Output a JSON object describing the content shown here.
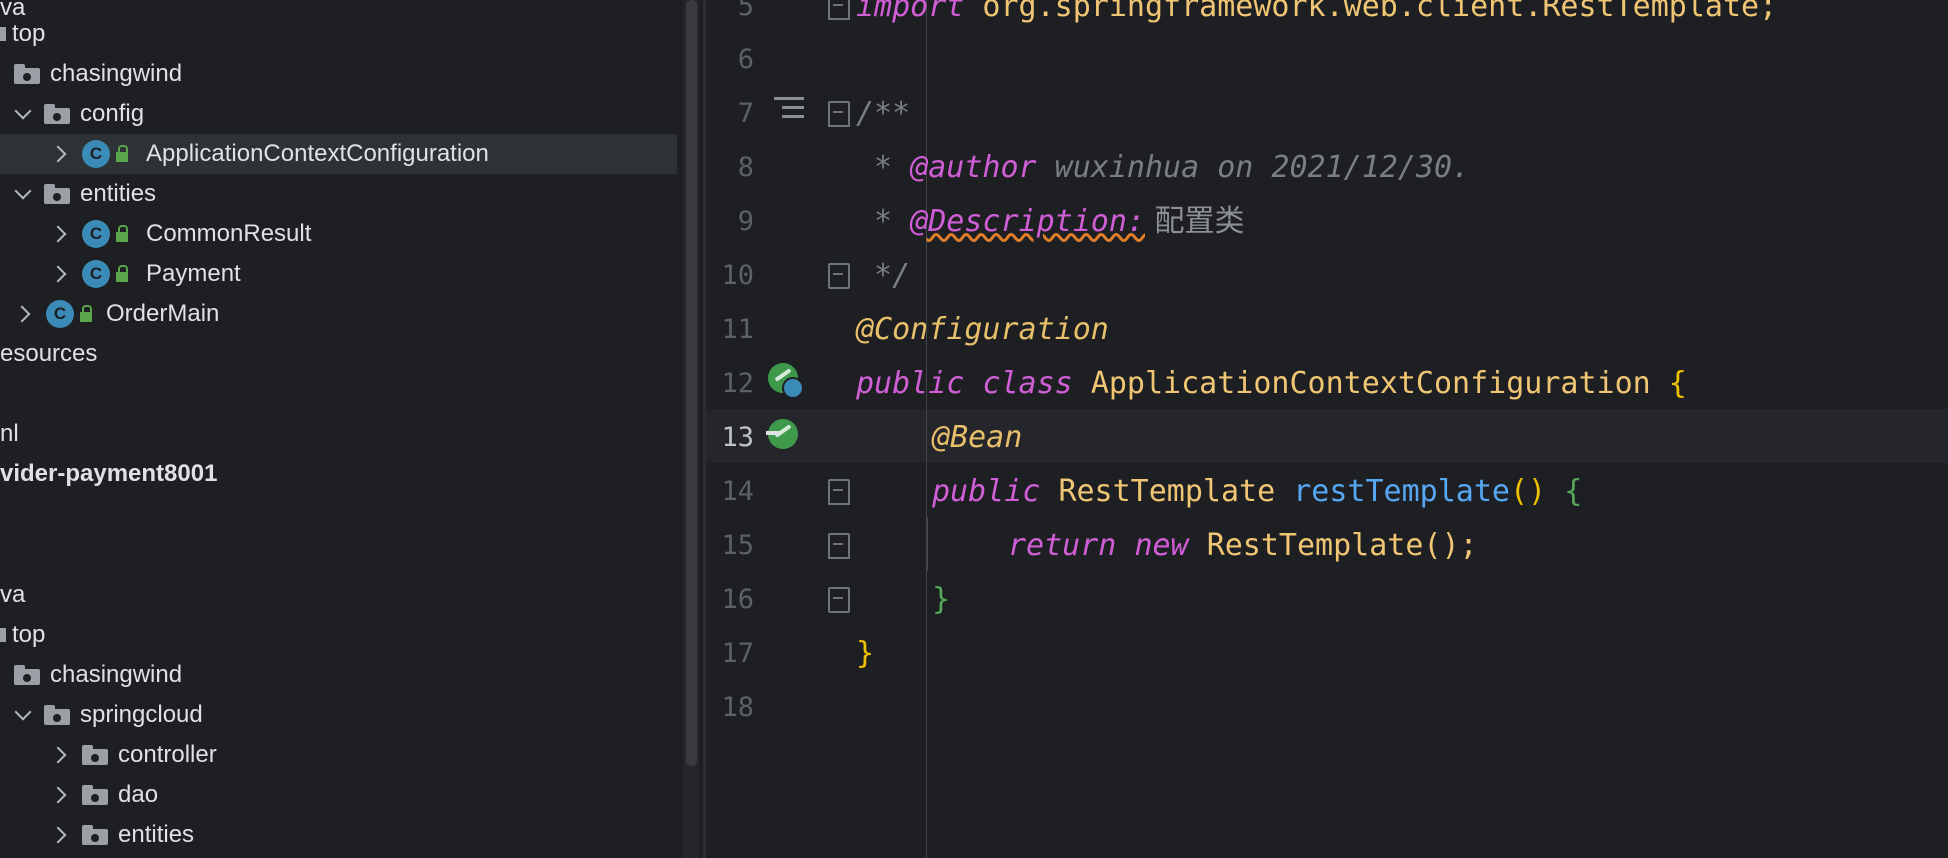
{
  "sidebar": {
    "rows": [
      {
        "label": "va",
        "indent": 0
      },
      {
        "label": "top"
      },
      {
        "label": "chasingwind"
      },
      {
        "label": "config"
      },
      {
        "label": "ApplicationContextConfiguration"
      },
      {
        "label": "entities"
      },
      {
        "label": "CommonResult"
      },
      {
        "label": "Payment"
      },
      {
        "label": "OrderMain"
      },
      {
        "label": "esources"
      },
      {
        "label": "nl"
      },
      {
        "label": "vider-payment8001"
      },
      {
        "label": "va"
      },
      {
        "label": "top"
      },
      {
        "label": "chasingwind"
      },
      {
        "label": "springcloud"
      },
      {
        "label": "controller"
      },
      {
        "label": "dao"
      },
      {
        "label": "entities"
      }
    ],
    "class_icon_letter": "C"
  },
  "editor": {
    "line_numbers": [
      "5",
      "6",
      "7",
      "8",
      "9",
      "10",
      "11",
      "12",
      "13",
      "14",
      "15",
      "16",
      "17",
      "18"
    ],
    "line5": {
      "kw": "import",
      "rest": " org.springframework.web.client.RestTemplate;"
    },
    "line7": "/**",
    "line8": {
      "star": " * ",
      "tag": "@author",
      "text": " wuxinhua on 2021/12/30."
    },
    "line9": {
      "star": " * ",
      "tag": "@Description:",
      "text": " 配置类"
    },
    "line10": " */",
    "line11": "@Configuration",
    "line12": {
      "kw1": "public",
      "kw2": "class",
      "name": "ApplicationContextConfiguration",
      "brace": "{"
    },
    "line13": "@Bean",
    "line14": {
      "kw": "public",
      "type": "RestTemplate",
      "fn": "restTemplate",
      "parens": "()",
      "brace": "{"
    },
    "line15": {
      "kw1": "return",
      "kw2": "new",
      "call": "RestTemplate();"
    },
    "line16": "}",
    "line17": "}",
    "current_line": "13"
  },
  "colors": {
    "background": "#1e1f22",
    "keyword": "#d05ed6",
    "annotation": "#e8bf6a",
    "class": "#f0c674",
    "function": "#56a8f5",
    "comment": "#7a7e85",
    "spring_bean": "#3e9a4a"
  }
}
